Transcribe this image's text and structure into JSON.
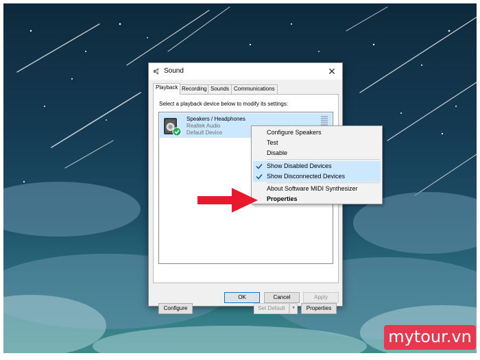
{
  "window": {
    "title": "Sound",
    "close_glyph": "✕"
  },
  "tabs": [
    {
      "label": "Playback",
      "active": true
    },
    {
      "label": "Recording",
      "active": false
    },
    {
      "label": "Sounds",
      "active": false
    },
    {
      "label": "Communications",
      "active": false
    }
  ],
  "playback": {
    "instruction": "Select a playback device below to modify its settings:",
    "device": {
      "name": "Speakers / Headphones",
      "driver": "Realtek Audio",
      "status": "Default Device",
      "icon": "speaker-icon",
      "badge": "green-checkmark"
    }
  },
  "panel_buttons": {
    "configure": "Configure",
    "set_default": "Set Default",
    "properties": "Properties"
  },
  "dialog_buttons": {
    "ok": "OK",
    "cancel": "Cancel",
    "apply": "Apply"
  },
  "context_menu": {
    "items": [
      {
        "label": "Configure Speakers",
        "checked": false,
        "bold": false
      },
      {
        "label": "Test",
        "checked": false,
        "bold": false
      },
      {
        "label": "Disable",
        "checked": false,
        "bold": false
      },
      {
        "label": "Show Disabled Devices",
        "checked": true,
        "bold": false
      },
      {
        "label": "Show Disconnected Devices",
        "checked": true,
        "bold": false
      },
      {
        "label": "About Software MIDI Synthesizer",
        "checked": false,
        "bold": false
      },
      {
        "label": "Properties",
        "checked": false,
        "bold": true
      }
    ]
  },
  "annotation": {
    "arrow_color": "#e8192c",
    "points_to": "Properties"
  },
  "watermark": {
    "text": "mytour.vn",
    "bg": "#e8384f"
  },
  "colors": {
    "selection": "#cce8ff",
    "accent": "#0078d7",
    "check_badge": "#1fa851"
  }
}
